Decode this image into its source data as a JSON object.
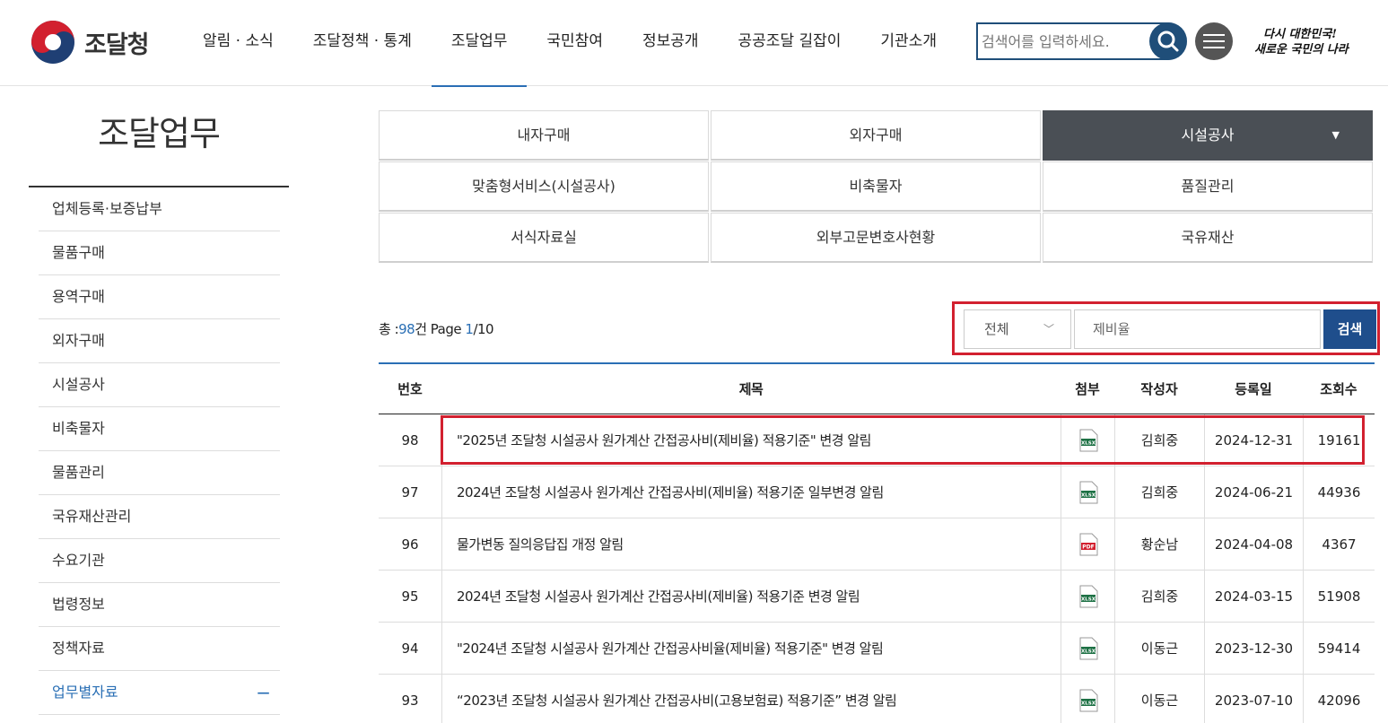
{
  "header": {
    "logo_text": "조달청",
    "nav": [
      "알림 · 소식",
      "조달정책 · 통계",
      "조달업무",
      "국민참여",
      "정보공개",
      "공공조달 길잡이",
      "기관소개"
    ],
    "active_nav_index": 2,
    "search_placeholder": "검색어를 입력하세요.",
    "slogan_line1": "다시 대한민국!",
    "slogan_line2": "새로운 국민의 나라"
  },
  "sidebar": {
    "title": "조달업무",
    "items": [
      "업체등록·보증납부",
      "물품구매",
      "용역구매",
      "외자구매",
      "시설공사",
      "비축물자",
      "물품관리",
      "국유재산관리",
      "수요기관",
      "법령정보",
      "정책자료",
      "업무별자료"
    ],
    "active_index": 11,
    "active_toggle": "−"
  },
  "tabs": [
    "내자구매",
    "외자구매",
    "시설공사",
    "맞춤형서비스(시설공사)",
    "비축물자",
    "품질관리",
    "서식자료실",
    "외부고문변호사현황",
    "국유재산"
  ],
  "active_tab_index": 2,
  "board_search": {
    "total_label": "총 :",
    "total_count": "98",
    "total_unit": "건 Page",
    "page_current": "1",
    "page_sep": "/",
    "page_total": "10",
    "select_value": "전체",
    "keyword": "제비율",
    "button": "검색"
  },
  "table": {
    "headers": [
      "번호",
      "제목",
      "첨부",
      "작성자",
      "등록일",
      "조회수"
    ],
    "rows": [
      {
        "no": "98",
        "title": "\"2025년 조달청 시설공사 원가계산 간접공사비(제비율) 적용기준\" 변경 알림",
        "file": "xlsx",
        "writer": "김희중",
        "date": "2024-12-31",
        "views": "19161"
      },
      {
        "no": "97",
        "title": "2024년 조달청 시설공사 원가계산 간접공사비(제비율) 적용기준 일부변경 알림",
        "file": "xlsx",
        "writer": "김희중",
        "date": "2024-06-21",
        "views": "44936"
      },
      {
        "no": "96",
        "title": "물가변동 질의응답집 개정 알림",
        "file": "pdf",
        "writer": "황순남",
        "date": "2024-04-08",
        "views": "4367"
      },
      {
        "no": "95",
        "title": "2024년 조달청 시설공사 원가계산 간접공사비(제비율) 적용기준 변경 알림",
        "file": "xlsx",
        "writer": "김희중",
        "date": "2024-03-15",
        "views": "51908"
      },
      {
        "no": "94",
        "title": "\"2024년 조달청 시설공사 원가계산 간접공사비율(제비율) 적용기준\" 변경 알림",
        "file": "xlsx",
        "writer": "이동근",
        "date": "2023-12-30",
        "views": "59414"
      },
      {
        "no": "93",
        "title": "“2023년 조달청 시설공사 원가계산 간접공사비(고용보험료) 적용기준” 변경 알림",
        "file": "xlsx",
        "writer": "이동근",
        "date": "2023-07-10",
        "views": "42096"
      }
    ]
  },
  "colors": {
    "accent": "#2a6fb5",
    "navy": "#1f4e79",
    "highlight": "#d2202f",
    "tab_active": "#4a4f55"
  }
}
